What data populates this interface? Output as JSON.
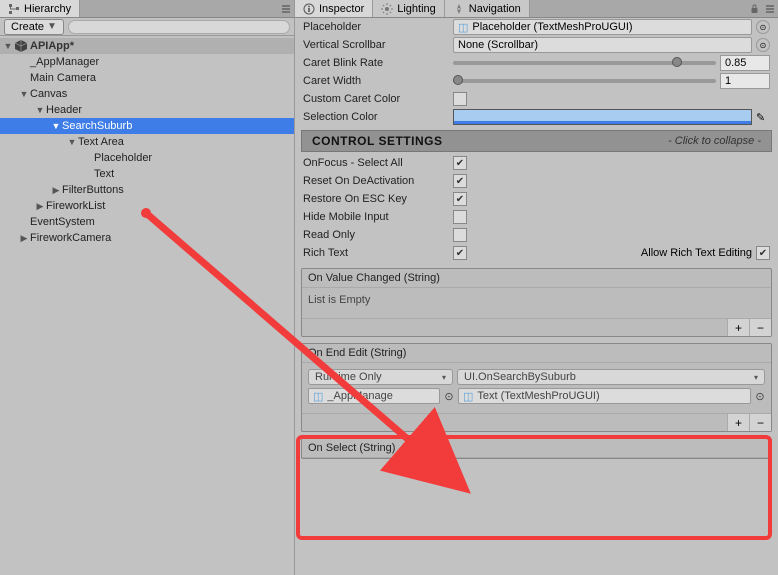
{
  "hierarchy": {
    "tab": "Hierarchy",
    "create": "Create",
    "scene": "APIApp*",
    "items": {
      "appmanager": "_AppManager",
      "maincamera": "Main Camera",
      "canvas": "Canvas",
      "header": "Header",
      "searchsuburb": "SearchSuburb",
      "textarea": "Text Area",
      "placeholder": "Placeholder",
      "text": "Text",
      "filterbuttons": "FilterButtons",
      "fireworklist": "FireworkList",
      "eventsystem": "EventSystem",
      "fireworkcamera": "FireworkCamera"
    }
  },
  "inspector": {
    "tabs": {
      "inspector": "Inspector",
      "lighting": "Lighting",
      "navigation": "Navigation"
    },
    "props": {
      "placeholder_label": "Placeholder",
      "placeholder_value": "Placeholder (TextMeshProUGUI)",
      "vscroll_label": "Vertical Scrollbar",
      "vscroll_value": "None (Scrollbar)",
      "blinkrate_label": "Caret Blink Rate",
      "blinkrate_value": "0.85",
      "caretwidth_label": "Caret Width",
      "caretwidth_value": "1",
      "customcaret_label": "Custom Caret Color",
      "selcolor_label": "Selection Color"
    },
    "control_settings": {
      "title": "CONTROL SETTINGS",
      "hint": "- Click to collapse -"
    },
    "controls": {
      "onfocus": "OnFocus - Select All",
      "resetdeact": "Reset On DeActivation",
      "restoreesc": "Restore On ESC Key",
      "hidemobile": "Hide Mobile Input",
      "readonly": "Read Only",
      "richtext": "Rich Text",
      "allowrte": "Allow Rich Text Editing"
    },
    "events": {
      "onvaluechanged": {
        "title": "On Value Changed (String)",
        "empty": "List is Empty"
      },
      "onendedit": {
        "title": "On End Edit (String)",
        "runtime": "Runtime Only",
        "func": "UI.OnSearchBySuburb",
        "obj": "_AppManage",
        "arg": "Text (TextMeshProUGUI)"
      },
      "onselect": {
        "title": "On Select (String)"
      }
    }
  }
}
